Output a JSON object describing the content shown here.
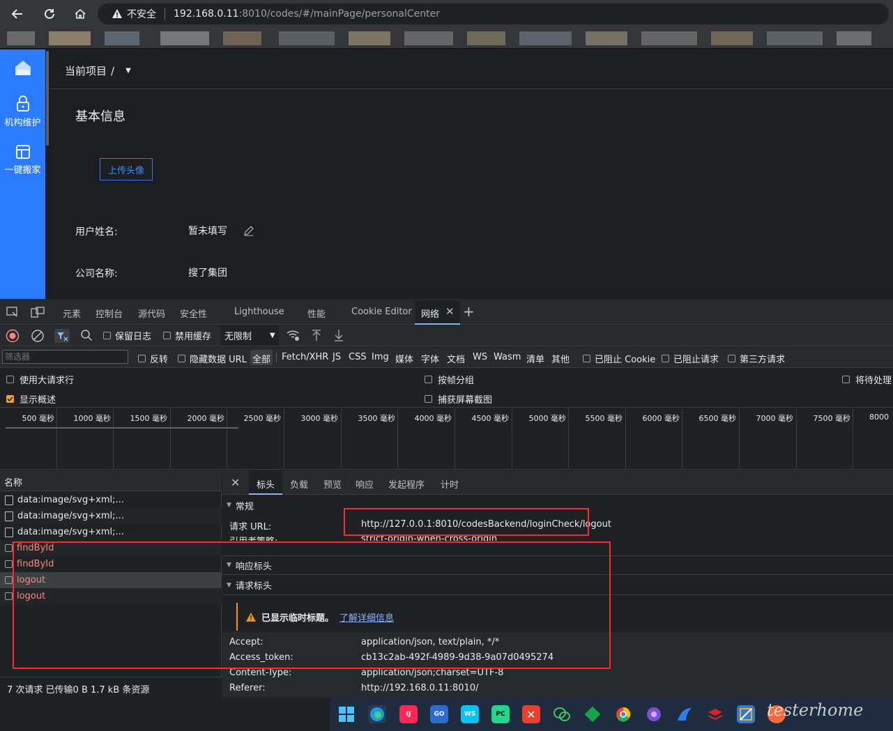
{
  "browser": {
    "back_icon": "arrow-left-icon",
    "insecure_label": "不安全",
    "url_host": "192.168.0.11",
    "url_path": ":8010/codes/#/mainPage/personalCenter"
  },
  "sidebar": {
    "items": [
      {
        "label": "",
        "icon": "home-icon"
      },
      {
        "label": "机构维护",
        "icon": "lock-icon"
      },
      {
        "label": "一键搬家",
        "icon": "layout-icon"
      }
    ]
  },
  "header": {
    "breadcrumb": "当前项目",
    "breadcrumb_sep": "/"
  },
  "profile": {
    "section_title": "基本信息",
    "upload_button": "上传头像",
    "fields": [
      {
        "label": "用户姓名:",
        "value": "暂未填写"
      },
      {
        "label": "公司名称:",
        "value": "搜了集团"
      }
    ]
  },
  "devtools": {
    "tabs": [
      "元素",
      "控制台",
      "源代码",
      "安全性",
      "Lighthouse",
      "性能",
      "Cookie Editor",
      "网络"
    ],
    "toolbar": {
      "preserve_log": "保留日志",
      "disable_cache": "禁用缓存",
      "throttle": "无限制"
    },
    "filter": {
      "placeholder": "筛选器",
      "invert": "反转",
      "hide_data_urls": "隐藏数据 URL",
      "types": [
        "全部",
        "Fetch/XHR",
        "JS",
        "CSS",
        "Img",
        "媒体",
        "字体",
        "文档",
        "WS",
        "Wasm",
        "清单",
        "其他"
      ],
      "blocked_cookies": "已阻止 Cookie",
      "blocked_requests": "已阻止请求",
      "third_party": "第三方请求"
    },
    "options": {
      "large_rows": "使用大请求行",
      "group_by_frame": "按帧分组",
      "show_overview": "显示概述",
      "capture_screenshots": "捕获屏幕截图",
      "pending": "将待处理"
    },
    "timeline_ticks": [
      "500 毫秒",
      "1000 毫秒",
      "1500 毫秒",
      "2000 毫秒",
      "2500 毫秒",
      "3000 毫秒",
      "3500 毫秒",
      "4000 毫秒",
      "4500 毫秒",
      "5000 毫秒",
      "5500 毫秒",
      "6000 毫秒",
      "6500 毫秒",
      "7000 毫秒",
      "7500 毫秒",
      "8000"
    ],
    "requests": {
      "header": "名称",
      "rows": [
        {
          "name": "data:image/svg+xml;...",
          "error": false
        },
        {
          "name": "data:image/svg+xml;...",
          "error": false
        },
        {
          "name": "data:image/svg+xml;...",
          "error": false
        },
        {
          "name": "findById",
          "error": true
        },
        {
          "name": "findById",
          "error": true
        },
        {
          "name": "logout",
          "error": true
        },
        {
          "name": "logout",
          "error": true
        }
      ],
      "status": "7 次请求  已传输0 B  1.7 kB 条资源"
    },
    "detail": {
      "tabs": [
        "标头",
        "负载",
        "预览",
        "响应",
        "发起程序",
        "计时"
      ],
      "general_title": "常规",
      "request_url_label": "请求 URL:",
      "request_url_value": "http://127.0.0.1:8010/codesBackend/loginCheck/logout",
      "referrer_policy_label": "引用者策略:",
      "referrer_policy_value": "strict-origin-when-cross-origin",
      "response_headers_title": "响应标头",
      "request_headers_title": "请求标头",
      "notice_text": "已显示临时标题。",
      "notice_link": "了解详细信息",
      "headers": [
        {
          "k": "Accept:",
          "v": "application/json, text/plain, */*"
        },
        {
          "k": "Access_token:",
          "v": "cb13c2ab-492f-4989-9d38-9a07d0495274"
        },
        {
          "k": "Content-Type:",
          "v": "application/json;charset=UTF-8"
        },
        {
          "k": "Referer:",
          "v": "http://192.168.0.11:8010/"
        }
      ]
    }
  },
  "taskbar": {
    "apps": [
      "start-icon",
      "edge-icon",
      "intellij-icon",
      "goland-icon",
      "webstorm-icon",
      "pycharm-icon",
      "xmind-icon",
      "wechat-icon",
      "git-icon",
      "chrome-icon",
      "app-icon",
      "app-icon",
      "app-icon",
      "app-icon"
    ],
    "watermark": "testerhome"
  },
  "colors": {
    "sidebar_accent": "#2b7bff",
    "error_text": "#f28b82",
    "annotation_red": "#ff2a2a"
  }
}
